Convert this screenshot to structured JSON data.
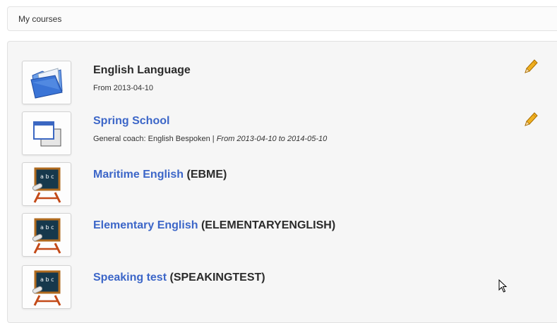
{
  "breadcrumb": {
    "label": "My courses"
  },
  "courses": [
    {
      "name": "English Language",
      "code": "",
      "line": "From 2013-04-10",
      "coach": "",
      "dates": "",
      "icon": "folder-icon",
      "editable": true
    },
    {
      "name": "Spring School",
      "code": "",
      "line": "",
      "coach": "General coach: English Bespoken | ",
      "dates": "From 2013-04-10 to 2014-05-10",
      "icon": "windows-icon",
      "editable": true
    },
    {
      "name": "Maritime English",
      "code": "(EBME)",
      "icon": "chalkboard-icon"
    },
    {
      "name": "Elementary English",
      "code": "(ELEMENTARYENGLISH)",
      "icon": "chalkboard-icon"
    },
    {
      "name": "Speaking test",
      "code": "(SPEAKINGTEST)",
      "icon": "chalkboard-icon"
    }
  ],
  "colors": {
    "link": "#3c66c8",
    "panel": "#f6f6f6",
    "pencil": "#f0b020"
  }
}
